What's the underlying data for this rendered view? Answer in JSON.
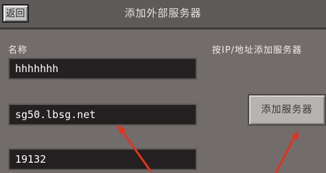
{
  "header": {
    "back_label": "返回",
    "title": "添加外部服务器"
  },
  "form": {
    "name_label": "名称",
    "hint": "按IP/地址添加服务器",
    "name_value": "hhhhhhh",
    "address_value": "sg50.lbsg.net",
    "port_value": "19132",
    "add_button_label": "添加服务器"
  },
  "colors": {
    "annotation_arrow": "#e8301c"
  }
}
